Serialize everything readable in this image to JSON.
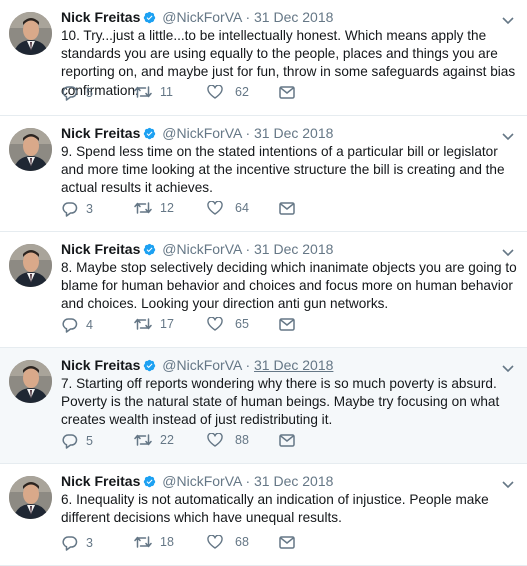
{
  "author": {
    "name": "Nick Freitas",
    "handle": "@NickForVA"
  },
  "tweets": [
    {
      "time": "31 Dec 2018",
      "text": "10. Try...just a little...to be intellectually honest. Which means apply the standards you are using equally to the people, places and things you are reporting on, and maybe just for fun, throw in some safeguards against bias confirmation.",
      "replies": "5",
      "retweets": "11",
      "likes": "62"
    },
    {
      "time": "31 Dec 2018",
      "text": "9. Spend less time on the stated intentions of a particular bill or legislator and more time looking at the incentive structure the bill is creating and the actual results it achieves.",
      "replies": "3",
      "retweets": "12",
      "likes": "64"
    },
    {
      "time": "31 Dec 2018",
      "text": "8. Maybe stop selectively deciding which inanimate objects you are going to blame for human behavior and choices and focus more on human behavior and choices. Looking your direction anti gun networks.",
      "replies": "4",
      "retweets": "17",
      "likes": "65"
    },
    {
      "time": "31 Dec 2018",
      "text": "7. Starting off reports wondering why there is so much poverty is absurd. Poverty is the natural state of human beings. Maybe try focusing on what creates wealth instead of just redistributing it.",
      "replies": "5",
      "retweets": "22",
      "likes": "88"
    },
    {
      "time": "31 Dec 2018",
      "text": "6. Inequality is not automatically an indication of injustice. People make different decisions which have unequal results.",
      "replies": "3",
      "retweets": "18",
      "likes": "68"
    }
  ],
  "colors": {
    "verified": "#1da1f2",
    "secondary": "#657786",
    "hover_bg": "#f5f8fa"
  },
  "icons": [
    "reply-icon",
    "retweet-icon",
    "like-icon",
    "direct-message-icon",
    "verified-badge-icon",
    "caret-down-icon"
  ]
}
